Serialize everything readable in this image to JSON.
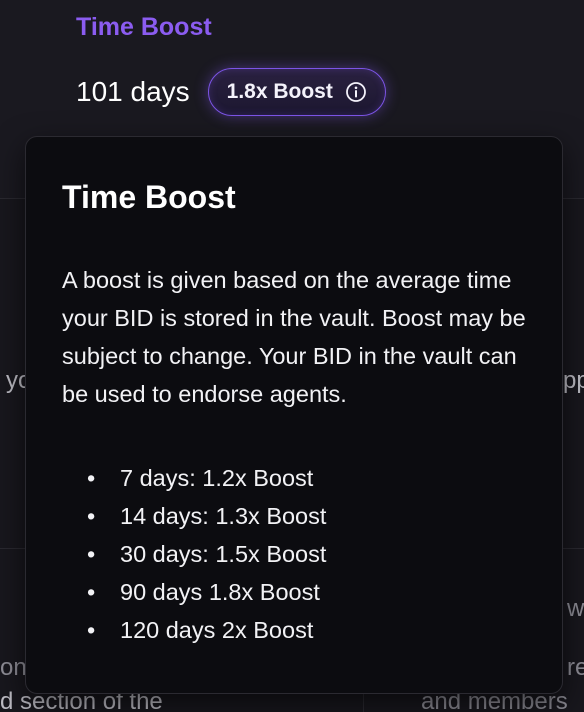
{
  "header": {
    "title": "Time Boost",
    "days_value": "101 days",
    "boost_badge": "1.8x Boost"
  },
  "tooltip": {
    "title": "Time Boost",
    "body": "A boost is given based on the average time your BID is stored in the vault. Boost may be subject to change. Your BID in the vault can be used to endorse agents.",
    "tiers": [
      "7 days: 1.2x Boost",
      "14 days: 1.3x Boost",
      "30 days: 1.5x Boost",
      "90 days 1.8x Boost",
      "120 days 2x Boost"
    ]
  },
  "background": {
    "left_fragment_1": "yo",
    "right_fragment_1": "pp",
    "right_fragment_2": "w",
    "left_fragment_2": "ont",
    "right_fragment_3": "re",
    "left_fragment_3": "d section of the",
    "right_fragment_4": "and members"
  },
  "colors": {
    "accent": "#8b5cf0",
    "tooltip_bg": "#0c0c10",
    "page_bg": "#18171d"
  },
  "icons": {
    "boost_info": "info-circle-icon"
  }
}
